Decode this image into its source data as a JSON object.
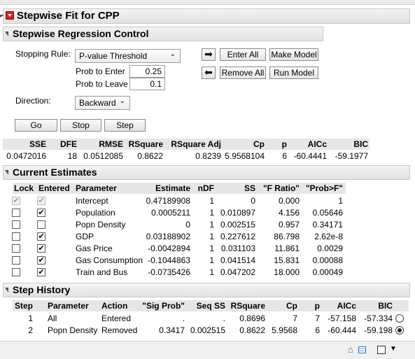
{
  "report": {
    "title": "Stepwise Fit for CPP"
  },
  "control": {
    "title": "Stepwise Regression Control",
    "stopping_rule_label": "Stopping Rule:",
    "stopping_rule_value": "P-value Threshold",
    "prob_enter_label": "Prob to Enter",
    "prob_enter_value": "0.25",
    "prob_leave_label": "Prob to Leave",
    "prob_leave_value": "0.1",
    "direction_label": "Direction:",
    "direction_value": "Backward",
    "enter_all": "Enter All",
    "remove_all": "Remove All",
    "make_model": "Make Model",
    "run_model": "Run Model",
    "go": "Go",
    "stop": "Stop",
    "step": "Step"
  },
  "summary": {
    "headers": [
      "SSE",
      "DFE",
      "RMSE",
      "RSquare",
      "RSquare Adj",
      "Cp",
      "p",
      "AICc",
      "BIC"
    ],
    "values": [
      "0.0472016",
      "18",
      "0.0512085",
      "0.8622",
      "0.8239",
      "5.9568104",
      "6",
      "-60.4441",
      "-59.1977"
    ]
  },
  "estimates": {
    "title": "Current Estimates",
    "headers": [
      "Lock",
      "Entered",
      "Parameter",
      "Estimate",
      "nDF",
      "SS",
      "\"F Ratio\"",
      "\"Prob>F\""
    ],
    "rows": [
      {
        "lock": true,
        "lock_disabled": true,
        "entered": true,
        "entered_disabled": true,
        "parameter": "Intercept",
        "estimate": "0.47189908",
        "ndf": "1",
        "ss": "0",
        "f": "0.000",
        "p": "1"
      },
      {
        "lock": false,
        "entered": true,
        "parameter": "Population",
        "estimate": "0.0005211",
        "ndf": "1",
        "ss": "0.010897",
        "f": "4.156",
        "p": "0.05646"
      },
      {
        "lock": false,
        "entered": false,
        "parameter": "Popn Density",
        "estimate": "0",
        "ndf": "1",
        "ss": "0.002515",
        "f": "0.957",
        "p": "0.34171"
      },
      {
        "lock": false,
        "entered": true,
        "parameter": "GDP",
        "estimate": "0.03188902",
        "ndf": "1",
        "ss": "0.227612",
        "f": "86.798",
        "p": "2.62e-8"
      },
      {
        "lock": false,
        "entered": true,
        "parameter": "Gas Price",
        "estimate": "-0.0042894",
        "ndf": "1",
        "ss": "0.031103",
        "f": "11.861",
        "p": "0.0029"
      },
      {
        "lock": false,
        "entered": true,
        "parameter": "Gas Consumption",
        "estimate": "-0.1044863",
        "ndf": "1",
        "ss": "0.041514",
        "f": "15.831",
        "p": "0.00088"
      },
      {
        "lock": false,
        "entered": true,
        "parameter": "Train and Bus",
        "estimate": "-0.0735426",
        "ndf": "1",
        "ss": "0.047202",
        "f": "18.000",
        "p": "0.00049"
      }
    ]
  },
  "history": {
    "title": "Step History",
    "headers": [
      "Step",
      "Parameter",
      "Action",
      "\"Sig Prob\"",
      "Seq SS",
      "RSquare",
      "Cp",
      "p",
      "AICc",
      "BIC"
    ],
    "rows": [
      {
        "step": "1",
        "parameter": "All",
        "action": "Entered",
        "sig": ".",
        "seq": ".",
        "rsq": "0.8696",
        "cp": "7",
        "p": "7",
        "aicc": "-57.158",
        "bic": "-57.334",
        "selected": false
      },
      {
        "step": "2",
        "parameter": "Popn Density",
        "action": "Removed",
        "sig": "0.3417",
        "seq": "0.002515",
        "rsq": "0.8622",
        "cp": "5.9568",
        "p": "6",
        "aicc": "-60.444",
        "bic": "-59.198",
        "selected": true
      }
    ]
  },
  "colors": {
    "red_menu": "#d11f1f",
    "header_bg": "#e6e6e6",
    "arrow": "#1a1a1a"
  }
}
